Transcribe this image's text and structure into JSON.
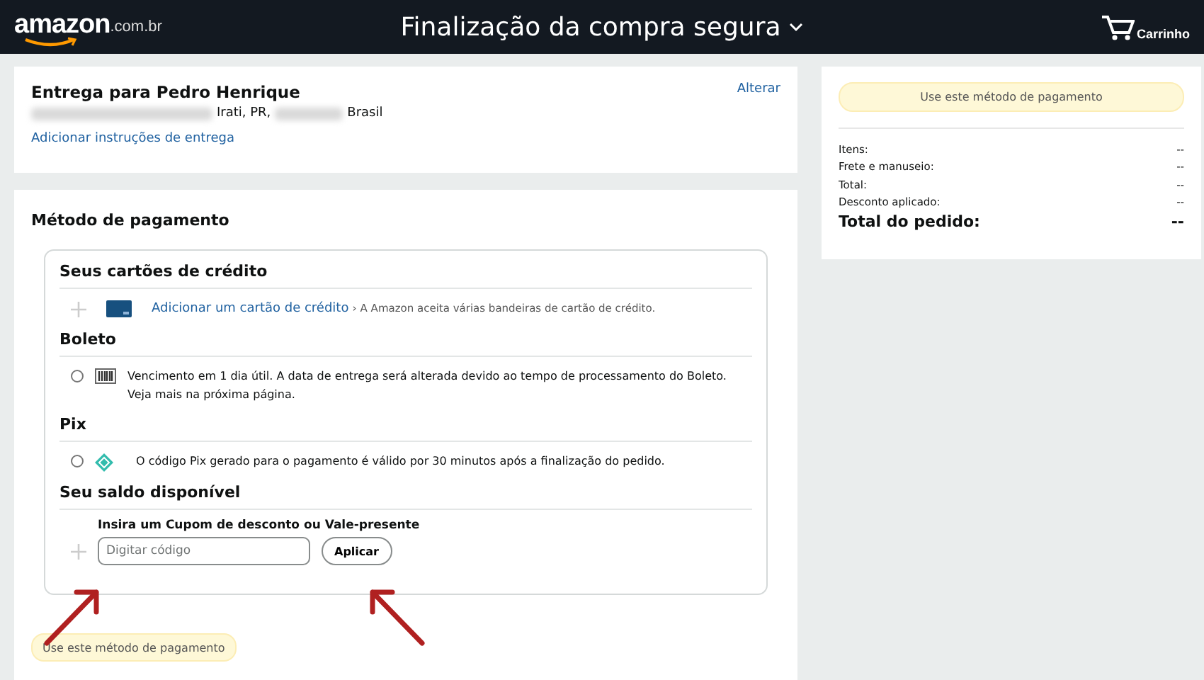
{
  "header": {
    "logo": "amazon",
    "logo_suffix": ".com.br",
    "title": "Finalização da compra segura",
    "cart_label": "Carrinho"
  },
  "delivery": {
    "heading": "Entrega para Pedro Henrique",
    "change_link": "Alterar",
    "address_parts": [
      {
        "kind": "redacted"
      },
      {
        "kind": "text",
        "text": "Irati, PR,"
      },
      {
        "kind": "redacted"
      },
      {
        "kind": "text",
        "text": "Brasil"
      }
    ],
    "instructions_link": "Adicionar instruções de entrega"
  },
  "payment": {
    "heading": "Método de pagamento",
    "sections": [
      {
        "title": "Seus cartões de crédito",
        "kind": "card",
        "link": "Adicionar um cartão de crédito",
        "chevron": "›",
        "note": "A Amazon aceita várias bandeiras de cartão de crédito."
      },
      {
        "title": "Boleto",
        "kind": "boleto",
        "selected": false,
        "text": "Vencimento em 1 dia útil. A data de entrega será alterada devido ao tempo de processamento do Boleto. Veja mais na próxima página."
      },
      {
        "title": "Pix",
        "kind": "pix",
        "selected": false,
        "text": "O código Pix gerado para o pagamento é válido por 30 minutos após a finalização do pedido."
      },
      {
        "title": "Seu saldo disponível",
        "kind": "coupon",
        "label": "Insira um Cupom de desconto ou Vale-presente",
        "placeholder": "Digitar código",
        "button": "Aplicar"
      }
    ],
    "use_button": "Use este método de pagamento"
  },
  "annotations": [
    {
      "kind": "arrow_up_right"
    },
    {
      "kind": "arrow_up_left"
    }
  ],
  "summary": {
    "use_button": "Use este método de pagamento",
    "rows": [
      {
        "label": "Itens:",
        "value": "--"
      },
      {
        "label": "Frete e manuseio:",
        "value": "--"
      },
      {
        "label": "Total:",
        "value": "--"
      },
      {
        "label": "Desconto aplicado:",
        "value": "--"
      }
    ],
    "total_label": "Total do pedido:",
    "total_value": "--"
  }
}
